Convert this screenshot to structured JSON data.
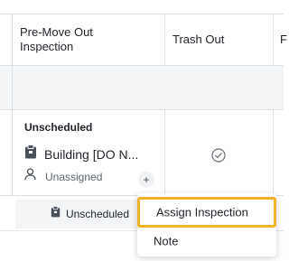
{
  "table": {
    "headers": [
      {
        "line1": "Pre-Move Out",
        "line2": "Inspection"
      },
      {
        "line1": "Trash Out",
        "line2": ""
      },
      {
        "line1": "F",
        "line2": ""
      }
    ]
  },
  "row": {
    "status": "Unscheduled",
    "building": "Building [DO N...",
    "assignee": "Unassigned",
    "add_symbol": "+"
  },
  "bottom": {
    "chip_label": "Unscheduled"
  },
  "menu": {
    "items": [
      {
        "label": "Assign Inspection",
        "highlighted": true
      },
      {
        "label": "Note",
        "highlighted": false
      }
    ]
  },
  "colors": {
    "highlight_border": "#f2b127",
    "band_bg": "#f3f4f6",
    "grid_line": "#dcdfe4"
  }
}
